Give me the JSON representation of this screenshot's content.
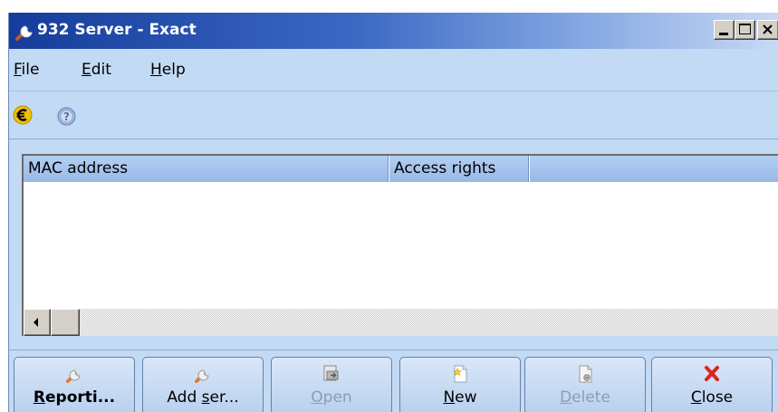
{
  "window": {
    "title": "932 Server - Exact",
    "caption_buttons": [
      "minimize",
      "maximize",
      "close"
    ]
  },
  "menu": {
    "file": {
      "accel": "F",
      "rest": "ile"
    },
    "edit": {
      "accel": "E",
      "rest": "dit"
    },
    "help": {
      "accel": "H",
      "rest": "elp"
    }
  },
  "toolbar": {
    "icons": [
      "exact-euro-icon",
      "help-icon"
    ]
  },
  "list": {
    "columns": [
      "MAC address",
      "Access rights",
      ""
    ],
    "rows": []
  },
  "buttons": {
    "reporting": {
      "accel": "R",
      "rest": "eporti...",
      "enabled": true,
      "default": true,
      "icon": "wrench-icon"
    },
    "add_server": {
      "pre": "Add ",
      "accel": "s",
      "rest": "er...",
      "enabled": true,
      "icon": "wrench-icon"
    },
    "open": {
      "accel": "O",
      "rest": "pen",
      "enabled": false,
      "icon": "open-folder-icon"
    },
    "new": {
      "accel": "N",
      "rest": "ew",
      "enabled": true,
      "icon": "new-document-icon"
    },
    "delete": {
      "accel": "D",
      "rest": "elete",
      "enabled": false,
      "icon": "delete-document-icon"
    },
    "close": {
      "accel": "C",
      "rest": "lose",
      "enabled": true,
      "icon": "red-x-icon"
    }
  },
  "colors": {
    "title_gradient_start": "#153c9a",
    "title_gradient_end": "#c7d9f5",
    "panel_background": "#c3daf5",
    "column_header": "#a2c2ec"
  }
}
